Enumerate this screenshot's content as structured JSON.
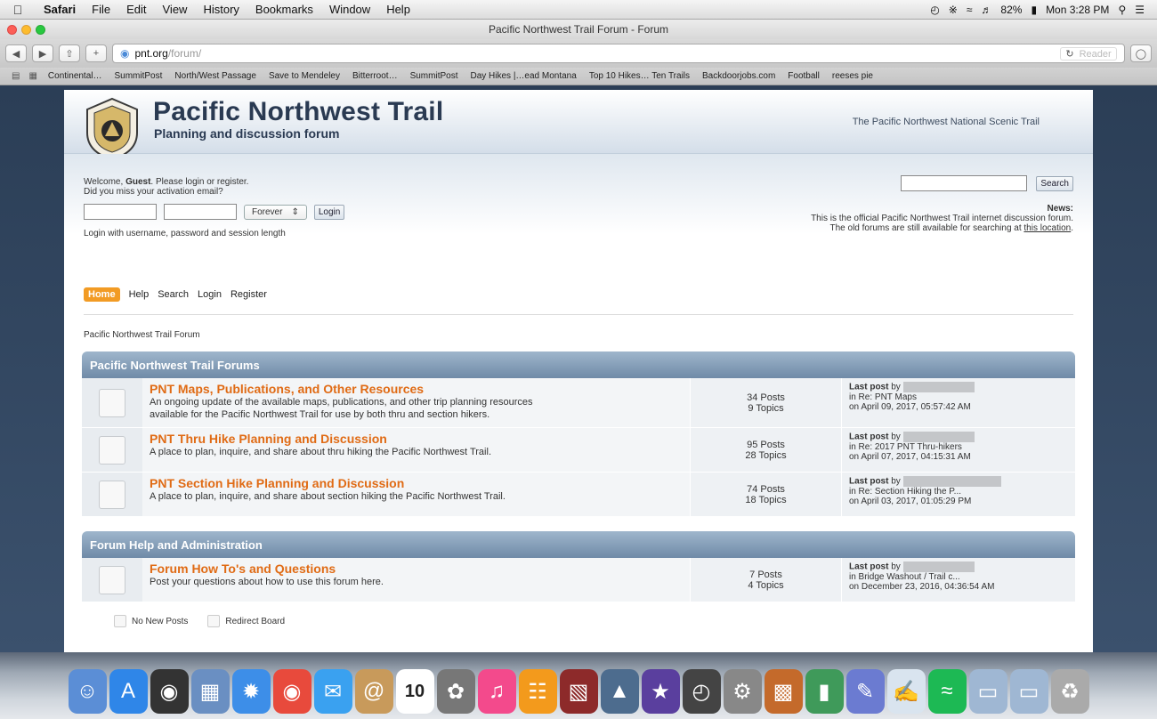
{
  "menubar": {
    "app": "Safari",
    "items": [
      "File",
      "Edit",
      "View",
      "History",
      "Bookmarks",
      "Window",
      "Help"
    ],
    "battery": "82%",
    "clock": "Mon 3:28 PM"
  },
  "window": {
    "title": "Pacific Northwest Trail Forum - Forum"
  },
  "address": {
    "host": "pnt.org",
    "path": "/forum/",
    "reader": "Reader"
  },
  "bookmarks": [
    "Continental…",
    "SummitPost",
    "North/West Passage",
    "Save to Mendeley",
    "Bitterroot…",
    "SummitPost",
    "Day Hikes |…ead Montana",
    "Top 10 Hikes… Ten Trails",
    "Backdoorjobs.com",
    "Football",
    "reeses pie"
  ],
  "header": {
    "title": "Pacific Northwest Trail",
    "subtitle": "Planning and discussion forum",
    "slogan": "The Pacific Northwest National Scenic Trail"
  },
  "user": {
    "welcome_prefix": "Welcome, ",
    "guest": "Guest",
    "welcome_suffix": ". Please login or register.",
    "activation": "Did you miss your activation email?",
    "session_length": "Forever",
    "login_button": "Login",
    "login_help": "Login with username, password and session length"
  },
  "search": {
    "button": "Search"
  },
  "news": {
    "title": "News:",
    "line1": "This is the official Pacific Northwest Trail internet discussion forum.",
    "line2_prefix": "The old forums are still available for searching at ",
    "line2_link": "this location",
    "line2_suffix": "."
  },
  "nav": {
    "home": "Home",
    "help": "Help",
    "search": "Search",
    "login": "Login",
    "register": "Register"
  },
  "breadcrumb": "Pacific Northwest Trail Forum",
  "categories": [
    {
      "name": "Pacific Northwest Trail Forums",
      "boards": [
        {
          "title": "PNT Maps, Publications, and Other Resources",
          "desc1": "An ongoing update of the available maps, publications, and other trip planning resources",
          "desc2": "available for the Pacific Northwest Trail for use by both thru and section hikers.",
          "posts": "34 Posts",
          "topics": "9 Topics",
          "last_label": "Last post",
          "by": " by",
          "in": "in Re: PNT Maps",
          "on": "on April 09, 2017, 05:57:42 AM"
        },
        {
          "title": "PNT Thru Hike Planning and Discussion",
          "desc1": "A place to plan, inquire, and share about thru hiking the Pacific Northwest Trail.",
          "desc2": "",
          "posts": "95 Posts",
          "topics": "28 Topics",
          "last_label": "Last post",
          "by": " by",
          "in": "in Re: 2017 PNT Thru-hikers",
          "on": "on April 07, 2017, 04:15:31 AM"
        },
        {
          "title": "PNT Section Hike Planning and Discussion",
          "desc1": "A place to plan, inquire, and share about section hiking the Pacific Northwest Trail.",
          "desc2": "",
          "posts": "74 Posts",
          "topics": "18 Topics",
          "last_label": "Last post",
          "by": " by",
          "in": "in Re: Section Hiking the P...",
          "on": "on April 03, 2017, 01:05:29 PM"
        }
      ]
    },
    {
      "name": "Forum Help and Administration",
      "boards": [
        {
          "title": "Forum How To's and Questions",
          "desc1": "Post your questions about how to use this forum here.",
          "desc2": "",
          "posts": "7 Posts",
          "topics": "4 Topics",
          "last_label": "Last post",
          "by": " by",
          "in": "in Bridge Washout / Trail c...",
          "on": "on December 23, 2016, 04:36:54 AM"
        }
      ]
    }
  ],
  "legend": {
    "no_new": "No New Posts",
    "redirect": "Redirect Board"
  },
  "dock": {
    "calendar_day": "10"
  },
  "colors": {
    "accent_orange": "#e06b15",
    "nav_active": "#f29b24",
    "category_bar": "#7e97b2"
  }
}
